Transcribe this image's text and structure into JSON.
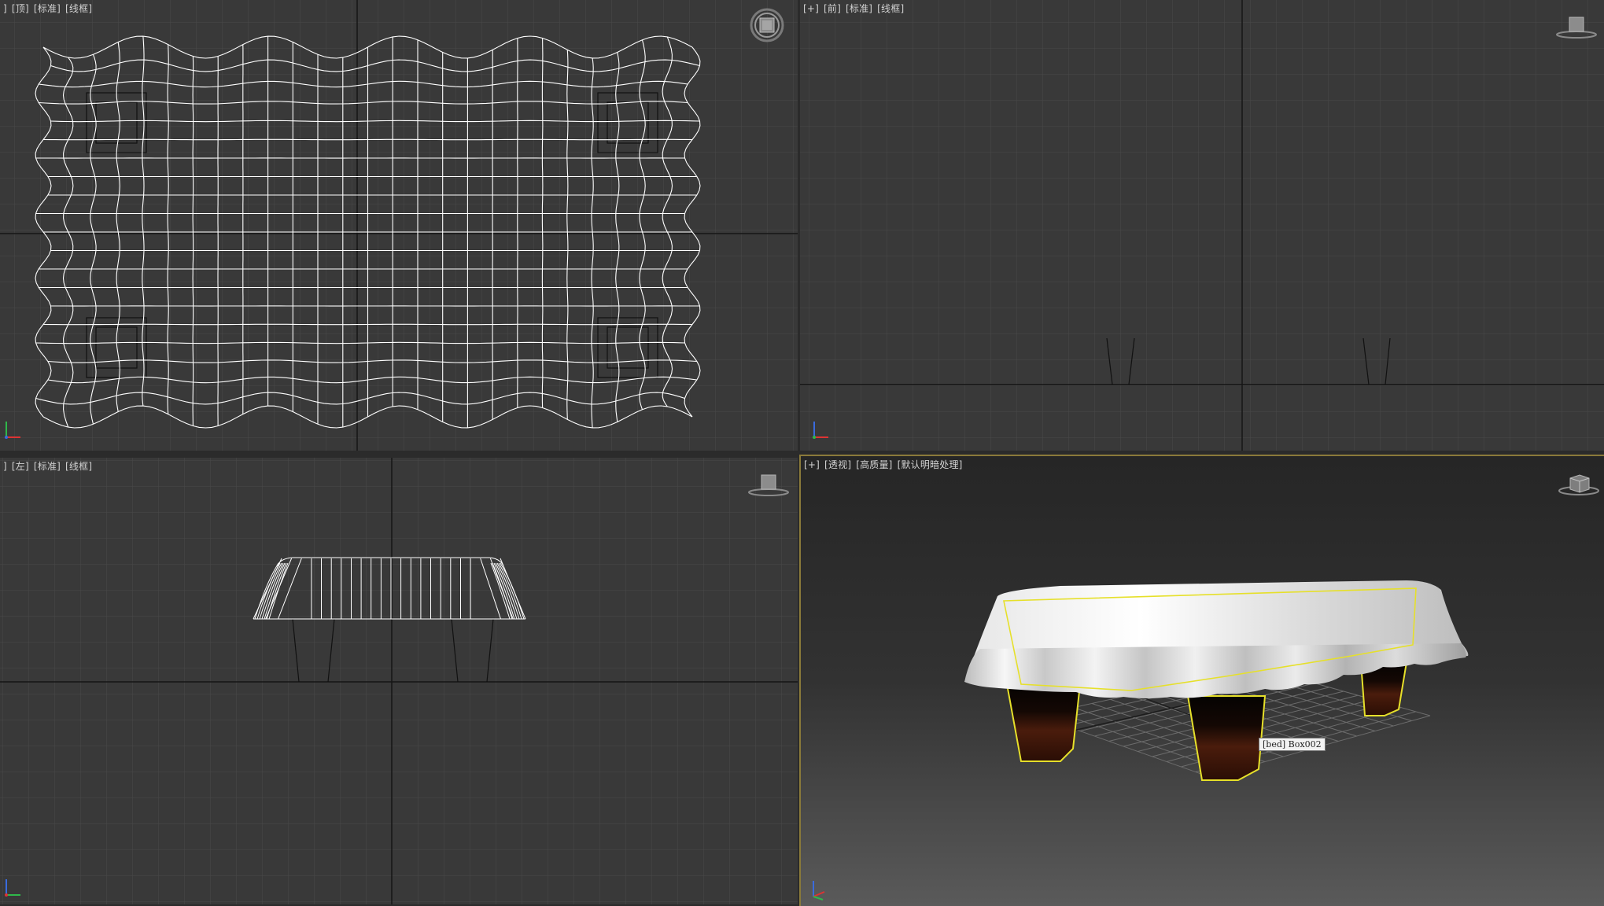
{
  "viewports": {
    "top": {
      "labels": [
        "]",
        "[顶]",
        "[标准]",
        "[线框]"
      ]
    },
    "front": {
      "labels": [
        "[+]",
        "[前]",
        "[标准]",
        "[线框]"
      ]
    },
    "left": {
      "labels": [
        "]",
        "[左]",
        "[标准]",
        "[线框]"
      ]
    },
    "perspective": {
      "labels": [
        "[+]",
        "[透视]",
        "[高质量]",
        "[默认明暗处理]"
      ]
    }
  },
  "object_tooltip": "[bed] Box002",
  "icons": {
    "top_view_cube": "steering-wheel-viewcube-icon",
    "front_view_cube": "viewcube-icon",
    "left_view_cube": "viewcube-icon",
    "perspective_view_cube": "viewcube-icon",
    "axis_tripod": "xyz-axis-icon"
  },
  "colors": {
    "viewport_bg": "#3a3a3a",
    "grid_line": "#4a4a4a",
    "grid_axis": "#1a1a1a",
    "wireframe": "#ffffff",
    "selection": "#e6e02a",
    "leg_wood": "#3a1408",
    "active_border": "#8a7a3a"
  }
}
